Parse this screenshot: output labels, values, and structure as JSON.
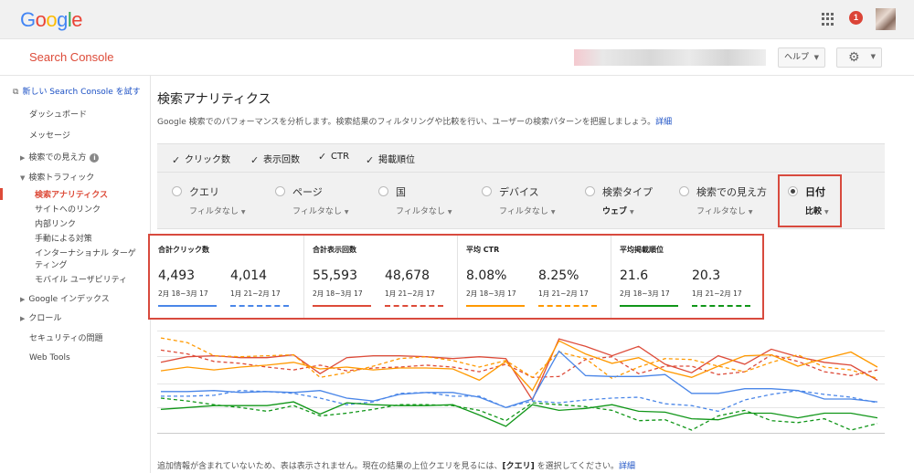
{
  "topbar": {
    "logo_letters": [
      {
        "ch": "G",
        "color": "#4285f4"
      },
      {
        "ch": "o",
        "color": "#ea4335"
      },
      {
        "ch": "o",
        "color": "#fbbc05"
      },
      {
        "ch": "g",
        "color": "#4285f4"
      },
      {
        "ch": "l",
        "color": "#34a853"
      },
      {
        "ch": "e",
        "color": "#ea4335"
      }
    ],
    "notification_count": "1"
  },
  "header": {
    "product_name": "Search Console",
    "help_label": "ヘルプ"
  },
  "sidebar": {
    "new_console_link": "新しい Search Console を試す",
    "items": [
      {
        "label": "ダッシュボード"
      },
      {
        "label": "メッセージ"
      },
      {
        "label": "検索での見え方"
      },
      {
        "label": "検索トラフィック"
      },
      {
        "label": "検索アナリティクス"
      },
      {
        "label": "サイトへのリンク"
      },
      {
        "label": "内部リンク"
      },
      {
        "label": "手動による対策"
      },
      {
        "label": "インターナショナル ターゲ"
      },
      {
        "label": "ティング"
      },
      {
        "label": "モバイル ユーザビリティ"
      },
      {
        "label": "Google インデックス"
      },
      {
        "label": "クロール"
      },
      {
        "label": "セキュリティの問題"
      },
      {
        "label": "Web Tools"
      }
    ]
  },
  "main": {
    "title": "検索アナリティクス",
    "description": "Google 検索でのパフォーマンスを分析します。検索結果のフィルタリングや比較を行い、ユーザーの検索パターンを把握しましょう。",
    "description_link": "詳細",
    "metrics": [
      {
        "label": "クリック数",
        "checked": true
      },
      {
        "label": "表示回数",
        "checked": true
      },
      {
        "label": "CTR",
        "checked": true
      },
      {
        "label": "掲載順位",
        "checked": true
      }
    ],
    "groups": [
      {
        "label": "クエリ",
        "filter": "フィルタなし"
      },
      {
        "label": "ページ",
        "filter": "フィルタなし"
      },
      {
        "label": "国",
        "filter": "フィルタなし"
      },
      {
        "label": "デバイス",
        "filter": "フィルタなし"
      },
      {
        "label": "検索タイプ",
        "filter": "ウェブ"
      },
      {
        "label": "検索での見え方",
        "filter": "フィルタなし"
      },
      {
        "label": "日付",
        "filter": "比較"
      }
    ],
    "summary": [
      {
        "title": "合計クリック数",
        "current": "4,493",
        "current_range": "2月 18~3月 17",
        "previous": "4,014",
        "previous_range": "1月 21~2月 17",
        "color": "#4a86e8"
      },
      {
        "title": "合計表示回数",
        "current": "55,593",
        "current_range": "2月 18~3月 17",
        "previous": "48,678",
        "previous_range": "1月 21~2月 17",
        "color": "#dd4b39"
      },
      {
        "title": "平均 CTR",
        "current": "8.08%",
        "current_range": "2月 18~3月 17",
        "previous": "8.25%",
        "previous_range": "1月 21~2月 17",
        "color": "#ff9900"
      },
      {
        "title": "平均掲載順位",
        "current": "21.6",
        "current_range": "2月 18~3月 17",
        "previous": "20.3",
        "previous_range": "1月 21~2月 17",
        "color": "#109618"
      }
    ],
    "footer_text": "追加情報が含まれていないため、表は表示されません。現在の結果の上位クエリを見るには、",
    "footer_bold": "[クエリ]",
    "footer_text2": " を選択してください。",
    "footer_link": "詳細"
  },
  "chart_data": {
    "type": "line",
    "x": [
      1,
      2,
      3,
      4,
      5,
      6,
      7,
      8,
      9,
      10,
      11,
      12,
      13,
      14,
      15,
      16,
      17,
      18,
      19,
      20,
      21,
      22,
      23,
      24,
      25,
      26,
      27,
      28
    ],
    "series": [
      {
        "color": "#dd4b39",
        "style": "solid",
        "values": [
          28,
          22,
          21,
          23,
          23,
          20,
          40,
          23,
          21,
          21,
          22,
          24,
          22,
          24,
          68,
          3,
          11,
          21,
          11,
          30,
          39,
          21,
          30,
          14,
          22,
          28,
          31,
          47
        ]
      },
      {
        "color": "#dd4b39",
        "style": "dashed",
        "values": [
          15,
          19,
          27,
          29,
          33,
          36,
          31,
          37,
          34,
          33,
          31,
          33,
          38,
          30,
          44,
          43,
          25,
          22,
          40,
          32,
          32,
          41,
          38,
          20,
          27,
          38,
          42,
          36
        ]
      },
      {
        "color": "#ff9900",
        "style": "solid",
        "values": [
          37,
          33,
          36,
          33,
          31,
          28,
          35,
          33,
          36,
          34,
          34,
          35,
          47,
          27,
          58,
          5,
          19,
          29,
          23,
          37,
          44,
          32,
          21,
          20,
          32,
          24,
          17,
          33
        ]
      },
      {
        "color": "#ff9900",
        "style": "dashed",
        "values": [
          2,
          7,
          21,
          22,
          21,
          20,
          44,
          39,
          32,
          24,
          22,
          26,
          33,
          26,
          44,
          17,
          24,
          45,
          33,
          24,
          25,
          32,
          38,
          28,
          20,
          33,
          36,
          45
        ]
      },
      {
        "color": "#4a86e8",
        "style": "solid",
        "values": [
          59,
          59,
          58,
          60,
          59,
          60,
          58,
          66,
          69,
          62,
          60,
          60,
          65,
          76,
          67,
          16,
          42,
          43,
          43,
          41,
          61,
          61,
          56,
          56,
          58,
          67,
          67,
          70
        ]
      },
      {
        "color": "#4a86e8",
        "style": "dashed",
        "values": [
          64,
          64,
          63,
          58,
          59,
          61,
          66,
          73,
          70,
          61,
          60,
          64,
          64,
          76,
          69,
          71,
          68,
          66,
          65,
          72,
          74,
          80,
          68,
          62,
          58,
          62,
          65,
          71
        ]
      },
      {
        "color": "#109618",
        "style": "solid",
        "values": [
          78,
          76,
          74,
          74,
          74,
          70,
          83,
          71,
          73,
          74,
          74,
          73,
          84,
          96,
          73,
          79,
          77,
          73,
          80,
          81,
          88,
          89,
          82,
          82,
          87,
          82,
          82,
          87
        ]
      },
      {
        "color": "#109618",
        "style": "dashed",
        "values": [
          66,
          69,
          73,
          76,
          80,
          74,
          85,
          82,
          78,
          73,
          73,
          74,
          79,
          90,
          71,
          73,
          75,
          79,
          90,
          89,
          100,
          85,
          79,
          90,
          92,
          88,
          100,
          93
        ]
      }
    ],
    "grid": true
  }
}
